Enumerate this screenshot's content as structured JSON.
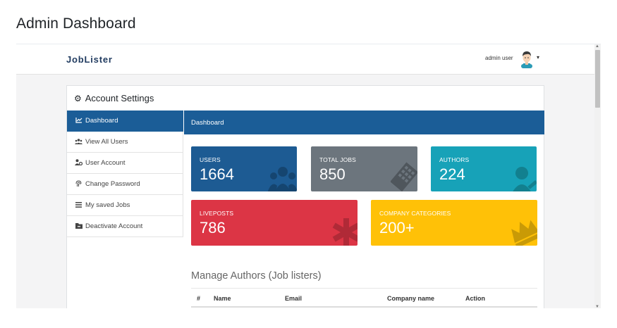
{
  "page_title": "Admin Dashboard",
  "navbar": {
    "brand": "JobLister",
    "user_name": "admin user",
    "avatar_icon": "user-avatar-icon",
    "caret": "▾"
  },
  "settings": {
    "title": "Account Settings",
    "title_icon": "gear-icon",
    "menu": [
      {
        "label": "Dashboard",
        "icon": "chart-line-icon",
        "active": true
      },
      {
        "label": "View All Users",
        "icon": "users-icon",
        "active": false
      },
      {
        "label": "User Account",
        "icon": "user-cog-icon",
        "active": false
      },
      {
        "label": "Change Password",
        "icon": "fingerprint-icon",
        "active": false
      },
      {
        "label": "My saved Jobs",
        "icon": "list-icon",
        "active": false
      },
      {
        "label": "Deactivate Account",
        "icon": "folder-minus-icon",
        "active": false
      }
    ]
  },
  "main": {
    "header": "Dashboard",
    "stats": {
      "users": {
        "label": "USERS",
        "value": "1664",
        "color": "#1d5b93"
      },
      "total_jobs": {
        "label": "TOTAL JOBS",
        "value": "850",
        "color": "#6c757d"
      },
      "authors": {
        "label": "AUTHORS",
        "value": "224",
        "color": "#17a2b8"
      },
      "liveposts": {
        "label": "LIVEPOSTS",
        "value": "786",
        "color": "#dc3545"
      },
      "company_categories": {
        "label": "COMPANY CATEGORIES",
        "value": "200+",
        "color": "#ffc107"
      }
    },
    "section_title": "Manage Authors (Job listers)",
    "table_headers": [
      "#",
      "Name",
      "Email",
      "Company name",
      "Action"
    ]
  }
}
